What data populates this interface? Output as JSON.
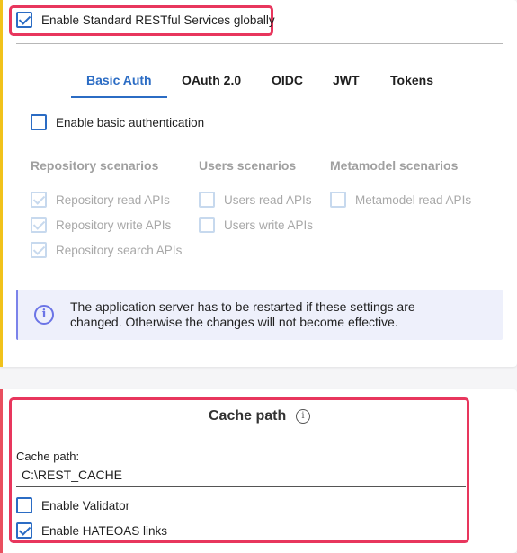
{
  "global": {
    "enable_label": "Enable Standard RESTful Services globally",
    "checked": true
  },
  "tabs": [
    {
      "label": "Basic Auth",
      "active": true
    },
    {
      "label": "OAuth 2.0",
      "active": false
    },
    {
      "label": "OIDC",
      "active": false
    },
    {
      "label": "JWT",
      "active": false
    },
    {
      "label": "Tokens",
      "active": false
    }
  ],
  "basic_auth": {
    "enable_label": "Enable basic authentication",
    "checked": false
  },
  "scenarios": {
    "repository": {
      "header": "Repository scenarios",
      "items": [
        {
          "label": "Repository read APIs",
          "checked": true
        },
        {
          "label": "Repository write APIs",
          "checked": true
        },
        {
          "label": "Repository search APIs",
          "checked": true
        }
      ]
    },
    "users": {
      "header": "Users scenarios",
      "items": [
        {
          "label": "Users read APIs",
          "checked": false
        },
        {
          "label": "Users write APIs",
          "checked": false
        }
      ]
    },
    "metamodel": {
      "header": "Metamodel scenarios",
      "items": [
        {
          "label": "Metamodel read APIs",
          "checked": false
        }
      ]
    }
  },
  "info_message": {
    "icon": "info-circle-icon",
    "text": "The application server has to be restarted if these settings are changed. Otherwise the changes will not become effective."
  },
  "cache_section": {
    "title": "Cache path",
    "title_icon": "info-icon",
    "field_label": "Cache path:",
    "field_value": "C:\\REST_CACHE",
    "validator_label": "Enable Validator",
    "validator_checked": false,
    "hateoas_label": "Enable HATEOAS links",
    "hateoas_checked": true
  },
  "colors": {
    "accent": "#2b6cc4",
    "highlight": "#e8365d",
    "info_bg": "#eef0fb",
    "left_bar_top": "#f1c21b",
    "left_bar_bottom": "#e94f5f"
  }
}
